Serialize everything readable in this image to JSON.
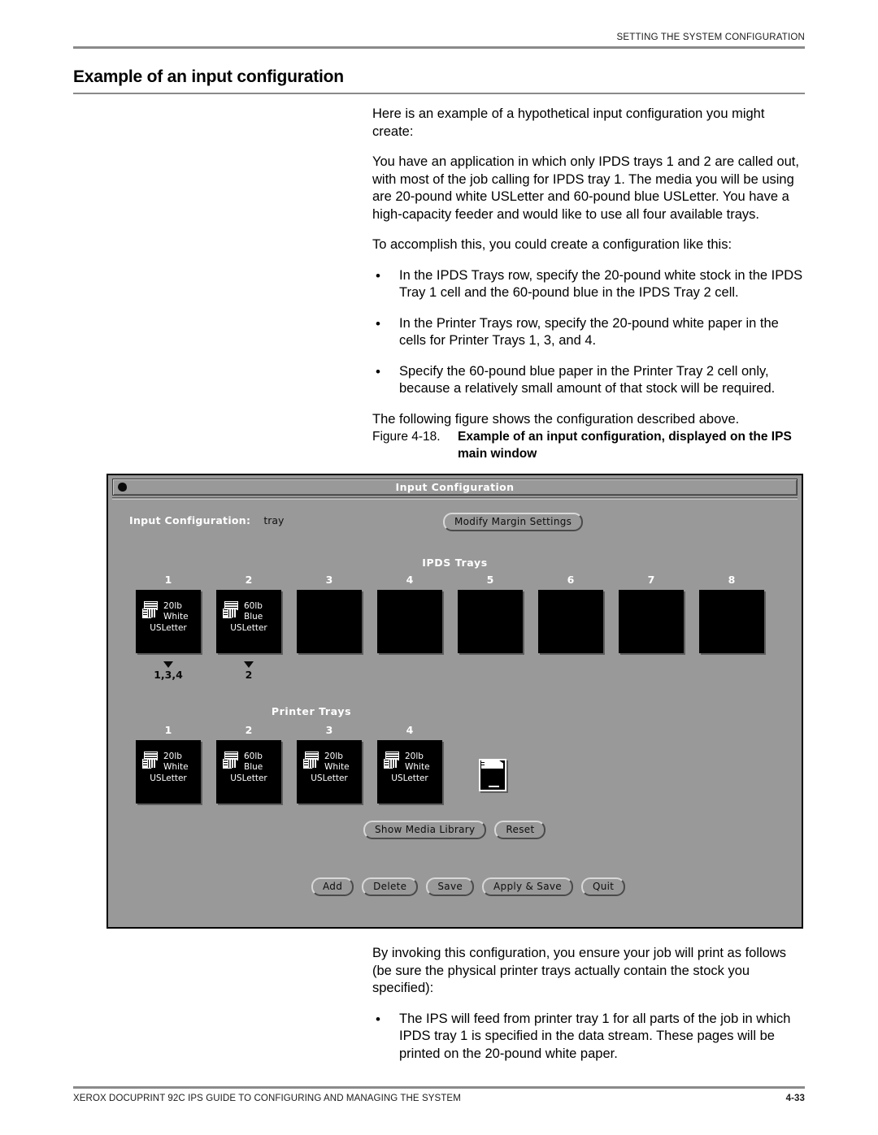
{
  "header": {
    "running_head": "SETTING THE SYSTEM CONFIGURATION"
  },
  "section": {
    "title": "Example of an input configuration"
  },
  "body": {
    "paragraphs": [
      "Here is an example of a hypothetical input configuration you might create:",
      "You have an application in which only IPDS trays 1 and 2 are called out, with most of the job calling for IPDS tray 1. The media you will be using are 20-pound white USLetter and 60-pound blue USLetter. You have a high-capacity feeder and would like to use all four available trays.",
      "To accomplish this, you could create a configuration like this:"
    ],
    "bullet_mark": "•",
    "bullets": [
      "In the IPDS Trays row, specify the 20-pound white stock in the IPDS Tray 1 cell and the 60-pound blue in the IPDS Tray 2 cell.",
      "In the Printer Trays row, specify the 20-pound white paper in the cells for Printer Trays 1, 3, and 4.",
      "Specify the 60-pound blue paper in the Printer Tray 2 cell only, because a relatively small amount of that stock will be required."
    ],
    "closing_paragraph": "The following figure shows the configuration described above.",
    "after_figure_paragraph": "By invoking this configuration, you ensure your job will print as follows (be sure the physical printer trays actually contain the stock you specified):",
    "after_figure_bullets": [
      "The IPS will feed from printer tray 1 for all parts of the job in which IPDS tray 1 is specified in the data stream. These pages will be printed on the 20-pound white paper."
    ]
  },
  "figure": {
    "number": "Figure 4-18.",
    "title": "Example of an input configuration, displayed on the IPS main window"
  },
  "window": {
    "title": "Input Configuration",
    "config_label": "Input Configuration:",
    "config_value": "tray",
    "modify_margin_button": "Modify Margin Settings",
    "ipds_heading": "IPDS Trays",
    "printer_heading": "Printer Trays",
    "ipds_trays": [
      {
        "num": "1",
        "weight": "20lb",
        "color": "White",
        "size": "USLetter",
        "empty": false
      },
      {
        "num": "2",
        "weight": "60lb",
        "color": "Blue",
        "size": "USLetter",
        "empty": false
      },
      {
        "num": "3",
        "weight": "",
        "color": "",
        "size": "",
        "empty": true
      },
      {
        "num": "4",
        "weight": "",
        "color": "",
        "size": "",
        "empty": true
      },
      {
        "num": "5",
        "weight": "",
        "color": "",
        "size": "",
        "empty": true
      },
      {
        "num": "6",
        "weight": "",
        "color": "",
        "size": "",
        "empty": true
      },
      {
        "num": "7",
        "weight": "",
        "color": "",
        "size": "",
        "empty": true
      },
      {
        "num": "8",
        "weight": "",
        "color": "",
        "size": "",
        "empty": true
      }
    ],
    "tray_mappings": [
      {
        "label": "1,3,4"
      },
      {
        "label": "2"
      }
    ],
    "printer_trays": [
      {
        "num": "1",
        "weight": "20lb",
        "color": "White",
        "size": "USLetter",
        "empty": false
      },
      {
        "num": "2",
        "weight": "60lb",
        "color": "Blue",
        "size": "USLetter",
        "empty": false
      },
      {
        "num": "3",
        "weight": "20lb",
        "color": "White",
        "size": "USLetter",
        "empty": false
      },
      {
        "num": "4",
        "weight": "20lb",
        "color": "White",
        "size": "USLetter",
        "empty": false
      }
    ],
    "mid_buttons": [
      "Show Media Library",
      "Reset"
    ],
    "bottom_buttons": [
      "Add",
      "Delete",
      "Save",
      "Apply & Save",
      "Quit"
    ]
  },
  "footer": {
    "text": "XEROX DOCUPRINT 92C IPS GUIDE TO CONFIGURING AND MANAGING THE SYSTEM",
    "page": "4-33"
  }
}
